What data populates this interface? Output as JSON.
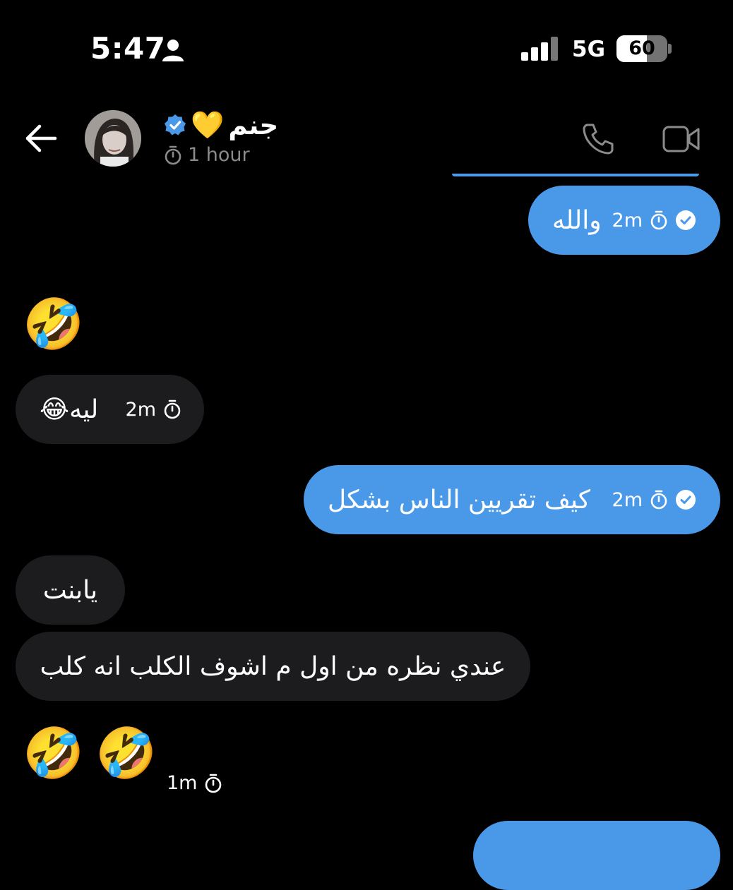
{
  "status_bar": {
    "time": "5:47",
    "network": "5G",
    "battery": "60",
    "battery_level": 0.6
  },
  "header": {
    "contact_name": "جنم",
    "heart_emoji": "💛",
    "disappearing_timer": "1 hour"
  },
  "messages": [
    {
      "direction": "out",
      "text": "والله",
      "time": "2m"
    },
    {
      "direction": "in",
      "emoji": "🤣"
    },
    {
      "direction": "in",
      "text": "ليه😂",
      "time": "2m"
    },
    {
      "direction": "out",
      "text": "كيف تقريين الناس بشكل",
      "time": "2m"
    },
    {
      "direction": "in",
      "text": "يابنت"
    },
    {
      "direction": "in",
      "text": "عندي نظره من اول م اشوف الكلب انه كلب"
    },
    {
      "direction": "in",
      "emoji": "🤣🤣",
      "time": "1m"
    }
  ],
  "colors": {
    "outgoing_bubble": "#4a99e9",
    "incoming_bubble": "#1c1c1e",
    "background": "#000000",
    "secondary_text": "#8b8b8b"
  }
}
